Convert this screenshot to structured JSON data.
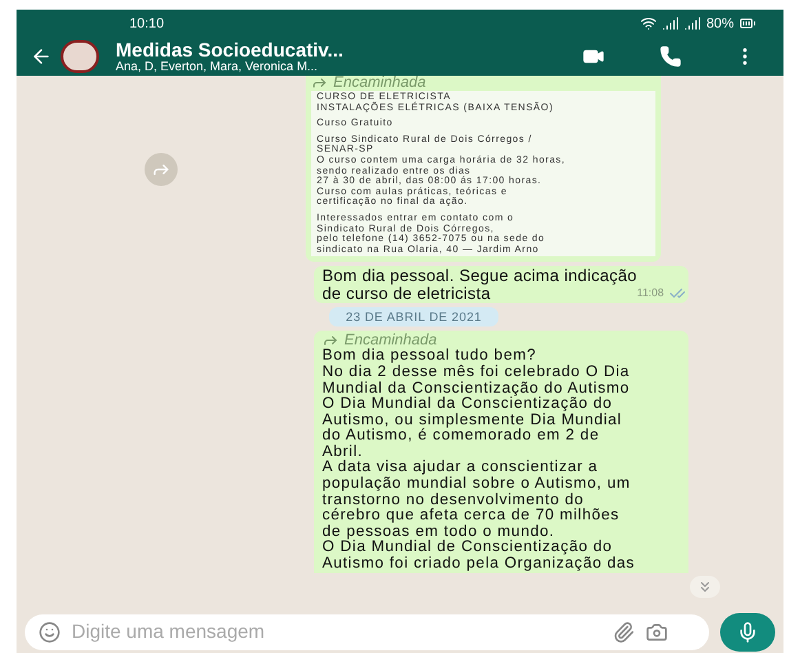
{
  "status_bar": {
    "time": "10:10",
    "battery": "80%"
  },
  "header": {
    "title": "Medidas Socioeducativ...",
    "subtitle": "Ana, D, Everton, Mara, Veronica M..."
  },
  "messages": [
    {
      "kind": "forwarded_card",
      "forwarded_label": "Encaminhada",
      "paragraphs": [
        [
          "CURSO DE  ELETRICISTA",
          "INSTALAÇÕES ELÉTRICAS (BAIXA TENSÃO)"
        ],
        [
          "Curso Gratuito"
        ],
        [
          "Curso Sindicato Rural de Dois Córregos /",
          "SENAR-SP",
          "O curso contem uma carga horária de 32 horas,",
          "sendo realizado entre os dias",
          "27 à 30 de abril, das 08:00 ás 17:00 horas.",
          "Curso com aulas práticas, teóricas e",
          "certificação no final da ação."
        ],
        [
          "Interessados entrar em contato com o",
          "Sindicato Rural de Dois Córregos,",
          "pelo telefone (14) 3652-7075 ou na sede do",
          "sindicato na Rua Olaria, 40 — Jardim Arno"
        ]
      ]
    },
    {
      "kind": "text",
      "lines": [
        "Bom dia pessoal. Segue acima indicação",
        "de curso de eletricista"
      ],
      "time": "11:08"
    },
    {
      "kind": "date",
      "label": "23 DE ABRIL DE 2021"
    },
    {
      "kind": "forwarded_text",
      "forwarded_label": "Encaminhada",
      "lines": [
        "Bom dia pessoal tudo bem?",
        "No dia 2  desse mês foi celebrado O Dia",
        "Mundial da Conscientização do Autismo",
        "O Dia Mundial da Conscientização do",
        "Autismo, ou simplesmente Dia Mundial",
        "do Autismo, é comemorado em 2 de",
        "Abril.",
        "A data visa ajudar a conscientizar a",
        "população mundial sobre o Autismo, um",
        "transtorno no desenvolvimento do",
        "cérebro que afeta cerca de 70 milhões",
        "de pessoas em todo o mundo.",
        "O Dia Mundial de Conscientização do",
        "Autismo foi criado pela Organização das"
      ]
    }
  ],
  "composer": {
    "placeholder": "Digite uma mensagem"
  }
}
